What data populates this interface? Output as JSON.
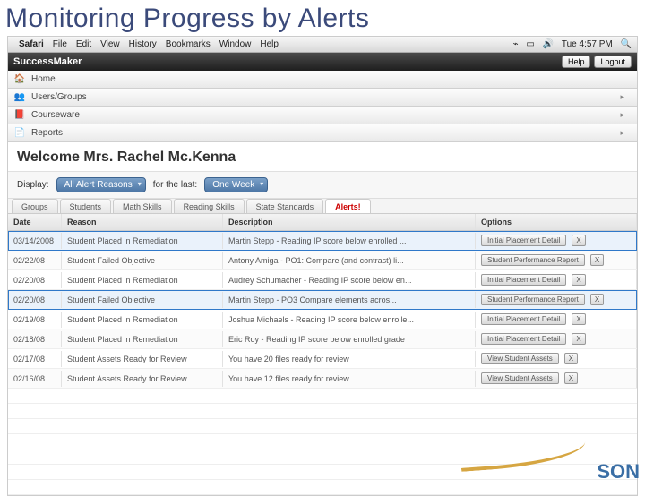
{
  "slide": {
    "title": "Monitoring Progress by Alerts"
  },
  "menubar": {
    "app": "Safari",
    "items": [
      "File",
      "Edit",
      "View",
      "History",
      "Bookmarks",
      "Window",
      "Help"
    ],
    "clock": "Tue 4:57 PM"
  },
  "apphdr": {
    "brand": "SuccessMaker",
    "help": "Help",
    "logout": "Logout"
  },
  "nav": [
    {
      "label": "Home",
      "icon": "home-icon",
      "expandable": false
    },
    {
      "label": "Users/Groups",
      "icon": "users-icon",
      "expandable": true
    },
    {
      "label": "Courseware",
      "icon": "book-icon",
      "expandable": true
    },
    {
      "label": "Reports",
      "icon": "report-icon",
      "expandable": true
    }
  ],
  "welcome": "Welcome Mrs. Rachel Mc.Kenna",
  "filter": {
    "display_label": "Display:",
    "reason_value": "All Alert Reasons",
    "forlast_label": "for the last:",
    "period_value": "One Week"
  },
  "tabs": [
    "Groups",
    "Students",
    "Math Skills",
    "Reading Skills",
    "State Standards"
  ],
  "tab_alert": "Alerts!",
  "columns": {
    "date": "Date",
    "reason": "Reason",
    "desc": "Description",
    "opt": "Options"
  },
  "rows": [
    {
      "date": "03/14/2008",
      "reason": "Student Placed in Remediation",
      "desc": "Martin Stepp - Reading IP score below enrolled ...",
      "opt": "Initial Placement Detail",
      "hl": true
    },
    {
      "date": "02/22/08",
      "reason": "Student Failed Objective",
      "desc": "Antony Amiga - PO1: Compare (and contrast) li...",
      "opt": "Student Performance Report"
    },
    {
      "date": "02/20/08",
      "reason": "Student Placed in Remediation",
      "desc": "Audrey Schumacher - Reading IP score below en...",
      "opt": "Initial Placement Detail"
    },
    {
      "date": "02/20/08",
      "reason": "Student Failed Objective",
      "desc": "Martin Stepp - PO3 Compare elements acros...",
      "opt": "Student Performance Report",
      "hl": true
    },
    {
      "date": "02/19/08",
      "reason": "Student Placed in Remediation",
      "desc": "Joshua Michaels - Reading IP score below enrolle...",
      "opt": "Initial Placement Detail"
    },
    {
      "date": "02/18/08",
      "reason": "Student Placed in Remediation",
      "desc": "Eric Roy - Reading IP score below enrolled grade",
      "opt": "Initial Placement Detail"
    },
    {
      "date": "02/17/08",
      "reason": "Student Assets Ready for Review",
      "desc": "You have 20 files ready for review",
      "opt": "View Student Assets"
    },
    {
      "date": "02/16/08",
      "reason": "Student Assets Ready for Review",
      "desc": "You have 12 files ready for review",
      "opt": "View Student Assets"
    }
  ],
  "close_x": "X",
  "watermark": "SON"
}
